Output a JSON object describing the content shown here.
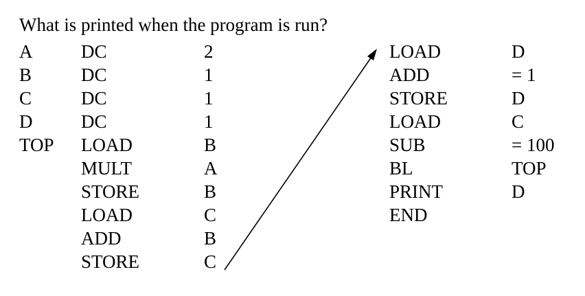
{
  "question": "What is printed when the program is run?",
  "left_program": [
    {
      "label": "A",
      "op": "DC",
      "arg": "2"
    },
    {
      "label": "B",
      "op": "DC",
      "arg": "1"
    },
    {
      "label": "C",
      "op": "DC",
      "arg": "1"
    },
    {
      "label": "D",
      "op": "DC",
      "arg": "1"
    },
    {
      "label": "TOP",
      "op": "LOAD",
      "arg": "B"
    },
    {
      "label": "",
      "op": "MULT",
      "arg": "A"
    },
    {
      "label": "",
      "op": "STORE",
      "arg": "B"
    },
    {
      "label": "",
      "op": "LOAD",
      "arg": "C"
    },
    {
      "label": "",
      "op": "ADD",
      "arg": "B"
    },
    {
      "label": "",
      "op": "STORE",
      "arg": "C"
    }
  ],
  "right_program": [
    {
      "op": "LOAD",
      "arg": "D"
    },
    {
      "op": "ADD",
      "arg": "= 1"
    },
    {
      "op": "STORE",
      "arg": "D"
    },
    {
      "op": "LOAD",
      "arg": "C"
    },
    {
      "op": "SUB",
      "arg": "= 100"
    },
    {
      "op": "BL",
      "arg": "TOP"
    },
    {
      "op": "PRINT",
      "arg": "D"
    },
    {
      "op": "END",
      "arg": ""
    }
  ]
}
